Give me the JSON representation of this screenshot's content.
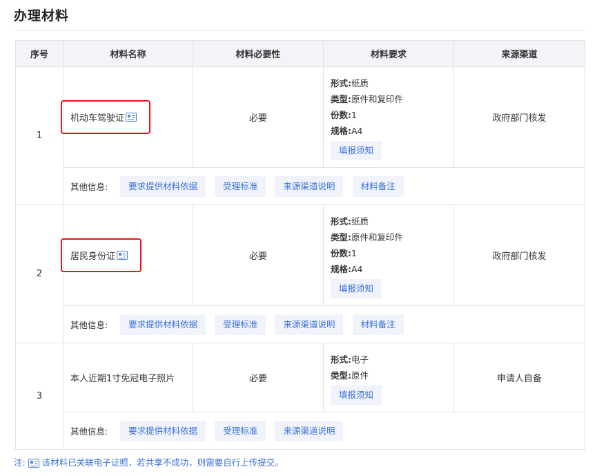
{
  "page": {
    "title": "办理材料"
  },
  "table": {
    "headers": [
      "序号",
      "材料名称",
      "材料必要性",
      "材料要求",
      "来源渠道"
    ],
    "other_label": "其他信息:",
    "rows": [
      {
        "seq": "1",
        "name": "机动车驾驶证",
        "has_cert_icon": true,
        "highlighted": true,
        "necessity": "必要",
        "requirements": [
          {
            "key": "形式:",
            "value": "纸质"
          },
          {
            "key": "类型:",
            "value": "原件和复印件"
          },
          {
            "key": "份数:",
            "value": "1"
          },
          {
            "key": "规格:",
            "value": "A4"
          }
        ],
        "notice_button": "填报须知",
        "source": "政府部门核发",
        "other_buttons": [
          "要求提供材料依据",
          "受理标准",
          "来源渠道说明",
          "材料备注"
        ]
      },
      {
        "seq": "2",
        "name": "居民身份证",
        "has_cert_icon": true,
        "highlighted": true,
        "necessity": "必要",
        "requirements": [
          {
            "key": "形式:",
            "value": "纸质"
          },
          {
            "key": "类型:",
            "value": "原件和复印件"
          },
          {
            "key": "份数:",
            "value": "1"
          },
          {
            "key": "规格:",
            "value": "A4"
          }
        ],
        "notice_button": "填报须知",
        "source": "政府部门核发",
        "other_buttons": [
          "要求提供材料依据",
          "受理标准",
          "来源渠道说明",
          "材料备注"
        ]
      },
      {
        "seq": "3",
        "name": "本人近期1寸免冠电子照片",
        "has_cert_icon": false,
        "highlighted": false,
        "necessity": "必要",
        "requirements": [
          {
            "key": "形式:",
            "value": "电子"
          },
          {
            "key": "类型:",
            "value": "原件"
          }
        ],
        "notice_button": "填报须知",
        "source": "申请人自备",
        "other_buttons": [
          "要求提供材料依据",
          "受理标准",
          "来源渠道说明"
        ]
      }
    ]
  },
  "footnote": {
    "prefix": "注:",
    "text": "该材料已关联电子证照，若共享不成功，则需要自行上传提交。"
  },
  "colors": {
    "accent": "#3a6fd8",
    "highlight": "#e8141b",
    "header_bg": "#f2f4f8",
    "button_bg": "#f0f3f9"
  },
  "icons": {
    "cert": "id-card-icon"
  }
}
